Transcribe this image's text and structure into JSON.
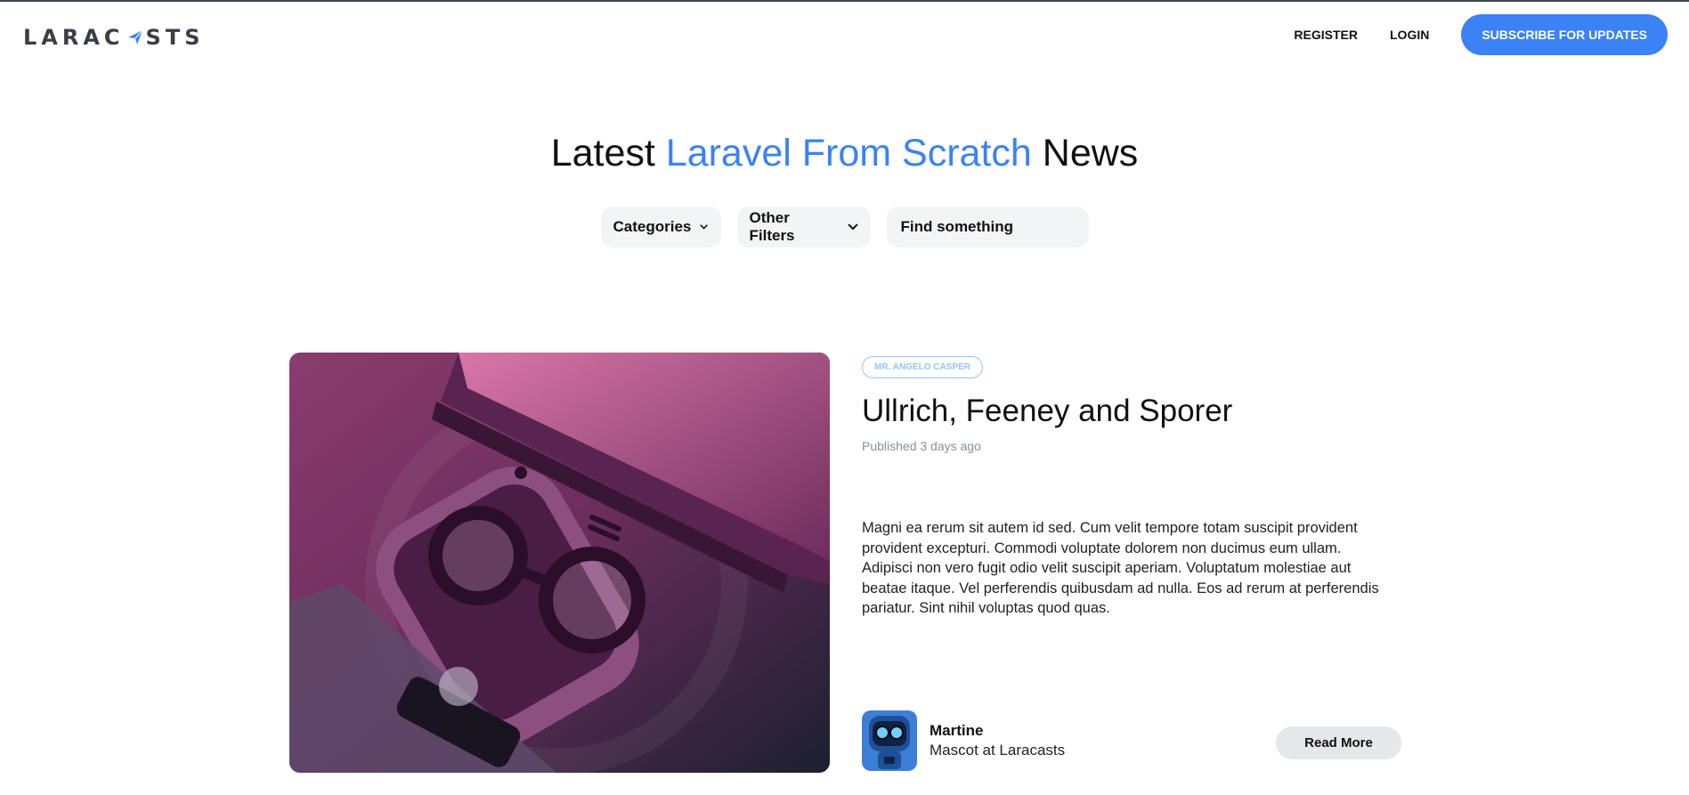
{
  "header": {
    "logo_text": "LARACASTS",
    "nav": {
      "register": "REGISTER",
      "login": "LOGIN",
      "subscribe": "SUBSCRIBE FOR UPDATES"
    }
  },
  "hero": {
    "title_prefix": "Latest",
    "title_accent": "Laravel From Scratch",
    "title_suffix": "News",
    "filters": {
      "categories": "Categories",
      "other_filters": "Other Filters",
      "search_placeholder": "Find something"
    }
  },
  "post": {
    "category": "MR. ANGELO CASPER",
    "title": "Ullrich, Feeney and Sporer",
    "published": "Published 3 days ago",
    "excerpt": "Magni ea rerum sit autem id sed. Cum velit tempore totam suscipit provident provident excepturi. Commodi voluptate dolorem non ducimus eum ullam. Adipisci non vero fugit odio velit suscipit aperiam. Voluptatum molestiae aut beatae itaque. Vel perferendis quibusdam ad nulla. Eos ad rerum at perferendis pariatur. Sint nihil voluptas quod quas.",
    "author_name": "Martine",
    "author_role": "Mascot at Laracasts",
    "read_more": "Read More"
  },
  "colors": {
    "accent": "#3b82f6",
    "badge": "#93c5fd",
    "filter_bg": "#f3f4f6"
  },
  "icons": [
    "chevron-down-icon",
    "logo-plane-icon"
  ]
}
